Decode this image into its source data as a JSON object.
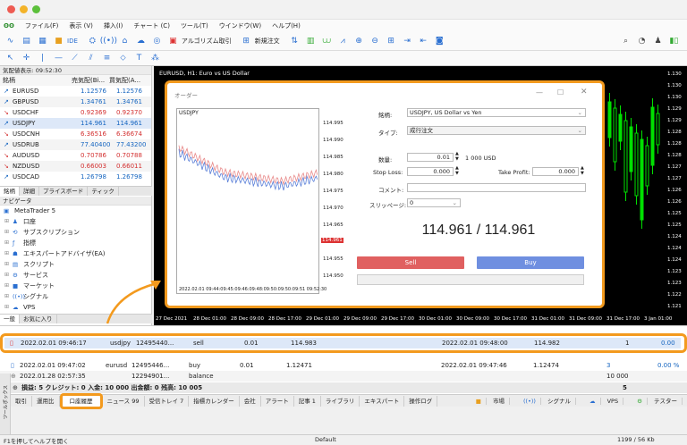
{
  "menu": [
    "ファイル(F)",
    "表示 (V)",
    "挿入(I)",
    "チャート (C)",
    "ツール(T)",
    "ウインドウ(W)",
    "ヘルプ(H)"
  ],
  "toolbar": {
    "ide": "IDE",
    "algo": "アルゴリズム取引",
    "new_order": "新規注文"
  },
  "market_watch": {
    "title": "気配値表示: 09:52:30",
    "headers": [
      "銘柄",
      "売気配(Bi...",
      "買気配(A..."
    ],
    "rows": [
      {
        "symbol": "EURUSD",
        "bid": "1.12576",
        "ask": "1.12576",
        "dir": "up"
      },
      {
        "symbol": "GBPUSD",
        "bid": "1.34761",
        "ask": "1.34761",
        "dir": "up"
      },
      {
        "symbol": "USDCHF",
        "bid": "0.92369",
        "ask": "0.92370",
        "dir": "dn"
      },
      {
        "symbol": "USDJPY",
        "bid": "114.961",
        "ask": "114.961",
        "dir": "up"
      },
      {
        "symbol": "USDCNH",
        "bid": "6.36516",
        "ask": "6.36674",
        "dir": "dn"
      },
      {
        "symbol": "USDRUB",
        "bid": "77.40400",
        "ask": "77.43200",
        "dir": "up"
      },
      {
        "symbol": "AUDUSD",
        "bid": "0.70786",
        "ask": "0.70788",
        "dir": "dn"
      },
      {
        "symbol": "NZDUSD",
        "bid": "0.66003",
        "ask": "0.66011",
        "dir": "dn"
      },
      {
        "symbol": "USDCAD",
        "bid": "1.26798",
        "ask": "1.26798",
        "dir": "up"
      }
    ],
    "tabs": [
      "銘柄",
      "詳細",
      "プライスボード",
      "ティック"
    ]
  },
  "navigator": {
    "title": "ナビゲータ",
    "items": [
      "MetaTrader 5",
      "口座",
      "サブスクリプション",
      "指標",
      "エキスパートアドバイザ(EA)",
      "スクリプト",
      "サービス",
      "マーケット",
      "シグナル",
      "VPS"
    ],
    "tabs": [
      "一般",
      "お気に入り"
    ]
  },
  "chart": {
    "title": "EURUSD, H1: Euro vs US Dollar",
    "price_labels": [
      "1.130",
      "1.130",
      "1.130",
      "1.129",
      "1.129",
      "1.128",
      "1.128",
      "1.128",
      "1.127",
      "1.127",
      "1.126",
      "1.126",
      "1.125",
      "1.125",
      "1.124",
      "1.124",
      "1.124",
      "1.123",
      "1.123",
      "1.122",
      "1.121"
    ],
    "time_labels": [
      "27 Dec 2021",
      "28 Dec 01:00",
      "28 Dec 09:00",
      "28 Dec 17:00",
      "29 Dec 01:00",
      "29 Dec 09:00",
      "29 Dec 17:00",
      "30 Dec 01:00",
      "30 Dec 09:00",
      "30 Dec 17:00",
      "31 Dec 01:00",
      "31 Dec 09:00",
      "31 Dec 17:00",
      "3 Jan 01:00"
    ]
  },
  "order_dialog": {
    "title": "オーダー",
    "mini_chart": {
      "symbol": "USDJPY",
      "prices": [
        "114.995",
        "114.990",
        "114.985",
        "114.980",
        "114.975",
        "114.970",
        "114.965",
        "114.960",
        "114.955",
        "114.950"
      ],
      "current": "114.961",
      "times": "2022.02.01 09:44:09:45:09:46:09:48:09:50:09:50:09:51 09:52:30"
    },
    "symbol_label": "銘柄:",
    "symbol_value": "USDJPY, US Dollar vs Yen",
    "type_label": "タイプ:",
    "type_value": "成行注文",
    "volume_label": "数量:",
    "volume_value": "0.01",
    "volume_note": "1 000 USD",
    "sl_label": "Stop Loss:",
    "sl_value": "0.000",
    "tp_label": "Take Profit:",
    "tp_value": "0.000",
    "comment_label": "コメント:",
    "slip_label": "スリッページ:",
    "slip_value": "0",
    "quote": "114.961 / 114.961",
    "sell": "Sell",
    "buy": "Buy"
  },
  "history": {
    "highlighted": {
      "time": "2022.02.01 09:46:17",
      "symbol": "usdjpy",
      "ticket": "12495440...",
      "type": "sell",
      "volume": "0.01",
      "price": "114.983",
      "close_time": "2022.02.01 09:48:00",
      "close_price": "114.982",
      "swap": "1",
      "profit": "0.00"
    },
    "rows": [
      {
        "time": "2022.02.01 09:47:02",
        "symbol": "eurusd",
        "ticket": "12495446...",
        "type": "buy",
        "volume": "0.01",
        "price": "1.12471",
        "close_time": "2022.02.01 09:47:46",
        "close_price": "1.12474",
        "swap": "3",
        "profit": "0.00 %"
      },
      {
        "time": "2022.01.28 02:57:35",
        "symbol": "",
        "ticket": "12294901...",
        "type": "balance",
        "volume": "",
        "price": "",
        "close_time": "",
        "close_price": "",
        "swap": "10 000",
        "profit": ""
      }
    ],
    "summary": "損益: 5 クレジット: 0 入金: 10 000 出金額: 0 残高: 10 005",
    "summary_right": "5"
  },
  "bottom_tabs": [
    "取引",
    "運用比",
    "口座履歴",
    "ニュース 99",
    "受信トレイ 7",
    "指標カレンダー",
    "会社",
    "アラート",
    "記事 1",
    "ライブラリ",
    "エキスパート",
    "操作ログ"
  ],
  "toolbox_label": "ツールボックス",
  "bottom_right": [
    "市場",
    "シグナル",
    "VPS",
    "テスター"
  ],
  "status": {
    "help": "F1を押してヘルプを開く",
    "profile": "Default",
    "traffic": "1199 / 56 Kb"
  },
  "colors": {
    "accent": "#f39a1e",
    "sell": "#e06060",
    "buy": "#6f8fe0",
    "chart_bg": "#000000",
    "candle": "#00e000"
  }
}
